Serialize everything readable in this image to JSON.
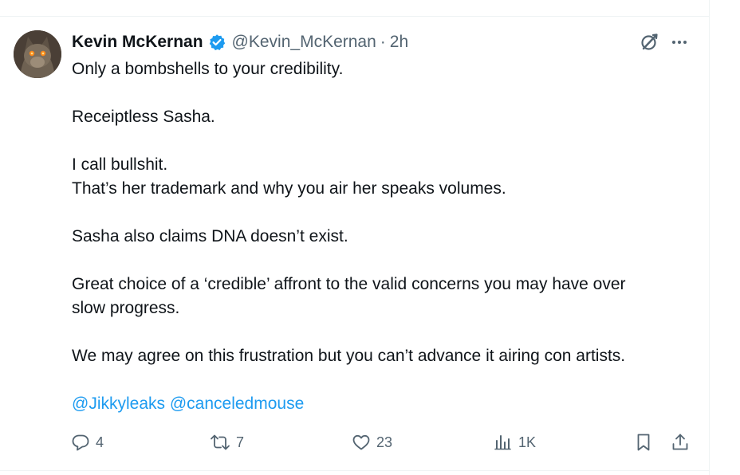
{
  "tweet": {
    "author": {
      "name": "Kevin McKernan",
      "handle": "@Kevin_McKernan",
      "verified": true,
      "avatar_icon": "cat-avatar"
    },
    "separator": "·",
    "time": "2h",
    "paragraphs": [
      [
        "Only a bombshells to your credibility."
      ],
      [
        "Receiptless Sasha."
      ],
      [
        "I call bullshit.",
        "That’s her trademark and why you air her speaks volumes."
      ],
      [
        "Sasha also claims DNA doesn’t exist."
      ],
      [
        "Great choice of a ‘credible’ affront to the valid concerns you may have over",
        "slow progress."
      ],
      [
        "We may agree on this frustration but you can’t advance it airing con artists."
      ]
    ],
    "mentions": [
      "@Jikkyleaks",
      "@canceledmouse"
    ],
    "actions": {
      "replies": "4",
      "reposts": "7",
      "likes": "23",
      "views": "1K"
    }
  },
  "icons": {
    "verified": "verified-badge-icon",
    "grok": "grok-icon",
    "more": "more-icon",
    "reply": "reply-icon",
    "repost": "repost-icon",
    "like": "heart-icon",
    "views": "views-icon",
    "bookmark": "bookmark-icon",
    "share": "share-icon"
  },
  "colors": {
    "text": "#0f1419",
    "secondary": "#536471",
    "accent": "#1d9bf0",
    "divider": "#eff3f4"
  }
}
